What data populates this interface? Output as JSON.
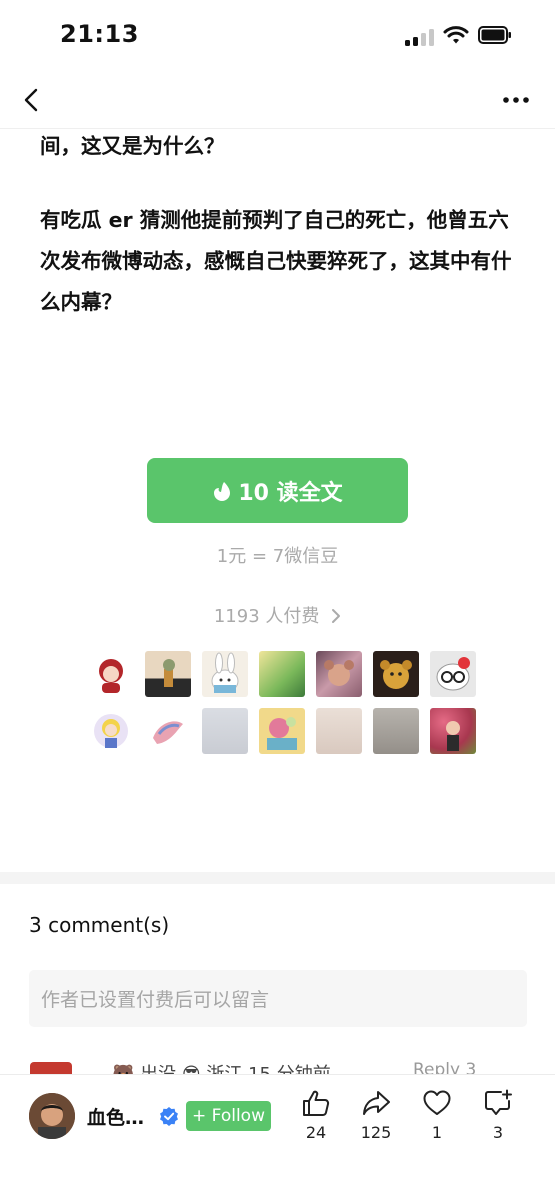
{
  "status_bar": {
    "time": "21:13"
  },
  "article": {
    "paragraphs": [
      "间，这又是为什么？",
      "有吃瓜 er 猜测他提前预判了自己的死亡，他曾五六次发布微博动态，感慨自己快要猝死了，这其中有什么内幕？"
    ]
  },
  "paywall": {
    "button_label": "10 读全文",
    "price_note": "1元 = 7微信豆",
    "payers_text": "1193 人付费"
  },
  "comments": {
    "count_label": "3 comment(s)",
    "input_placeholder": "作者已设置付费后可以留言",
    "peek_text": "🐻 出没 😎  浙江  15 分钟前",
    "peek_right": "Reply   3"
  },
  "bottom_bar": {
    "author_name": "血色…",
    "follow_label": "+ Follow",
    "like_count": "24",
    "share_count": "125",
    "heart_count": "1",
    "comment_count": "3"
  },
  "colors": {
    "accent_green": "#5ac56b",
    "verified_blue": "#3b82f6"
  },
  "icons": [
    "back-icon",
    "more-icon",
    "coin-icon",
    "chevron-right-icon",
    "verified-icon",
    "thumbs-up-icon",
    "share-icon",
    "heart-icon",
    "comment-plus-icon"
  ]
}
